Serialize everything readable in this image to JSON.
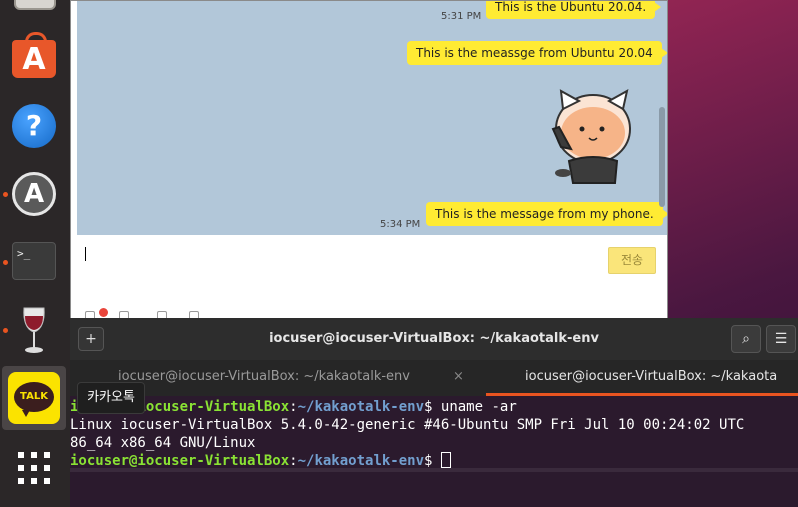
{
  "dock": {
    "kakao_logo_text": "TALK",
    "terminal_glyph": ">_",
    "help_glyph": "?",
    "store_glyph": "A",
    "updater_glyph": "A"
  },
  "tooltip": {
    "text": "카카오톡"
  },
  "chat": {
    "messages": [
      {
        "text": "This is the Ubuntu 20.04.",
        "time": "5:31 PM"
      },
      {
        "text": "This is the meassge from Ubuntu 20.04",
        "time": ""
      },
      {
        "text": "This is the message from my phone.",
        "time": "5:34 PM"
      }
    ],
    "send_label": "전송"
  },
  "terminal": {
    "title": "iocuser@iocuser-VirtualBox: ~/kakaotalk-env",
    "new_tab_glyph": "+",
    "search_glyph": "⌕",
    "menu_glyph": "☰",
    "tabs": [
      {
        "label": "iocuser@iocuser-VirtualBox: ~/kakaotalk-env",
        "close": "×"
      },
      {
        "label": "iocuser@iocuser-VirtualBox: ~/kakaota"
      }
    ],
    "prompt_user": "iocuser@iocuser-VirtualBox",
    "prompt_sep": ":",
    "prompt_path": "~/kakaotalk-env",
    "prompt_end": "$ ",
    "command": "uname -ar",
    "output_1": "Linux iocuser-VirtualBox 5.4.0-42-generic #46-Ubuntu SMP Fri Jul 10 00:24:02 UTC",
    "output_2": "86_64 x86_64 GNU/Linux"
  },
  "colors": {
    "ubuntu_orange": "#e95420",
    "kakao_yellow": "#fbe300",
    "chat_bg": "#b2c7d9",
    "bubble": "#ffeb33",
    "terminal_bg": "#2b1a2d",
    "prompt_green": "#8ae234",
    "prompt_blue": "#729fcf"
  }
}
